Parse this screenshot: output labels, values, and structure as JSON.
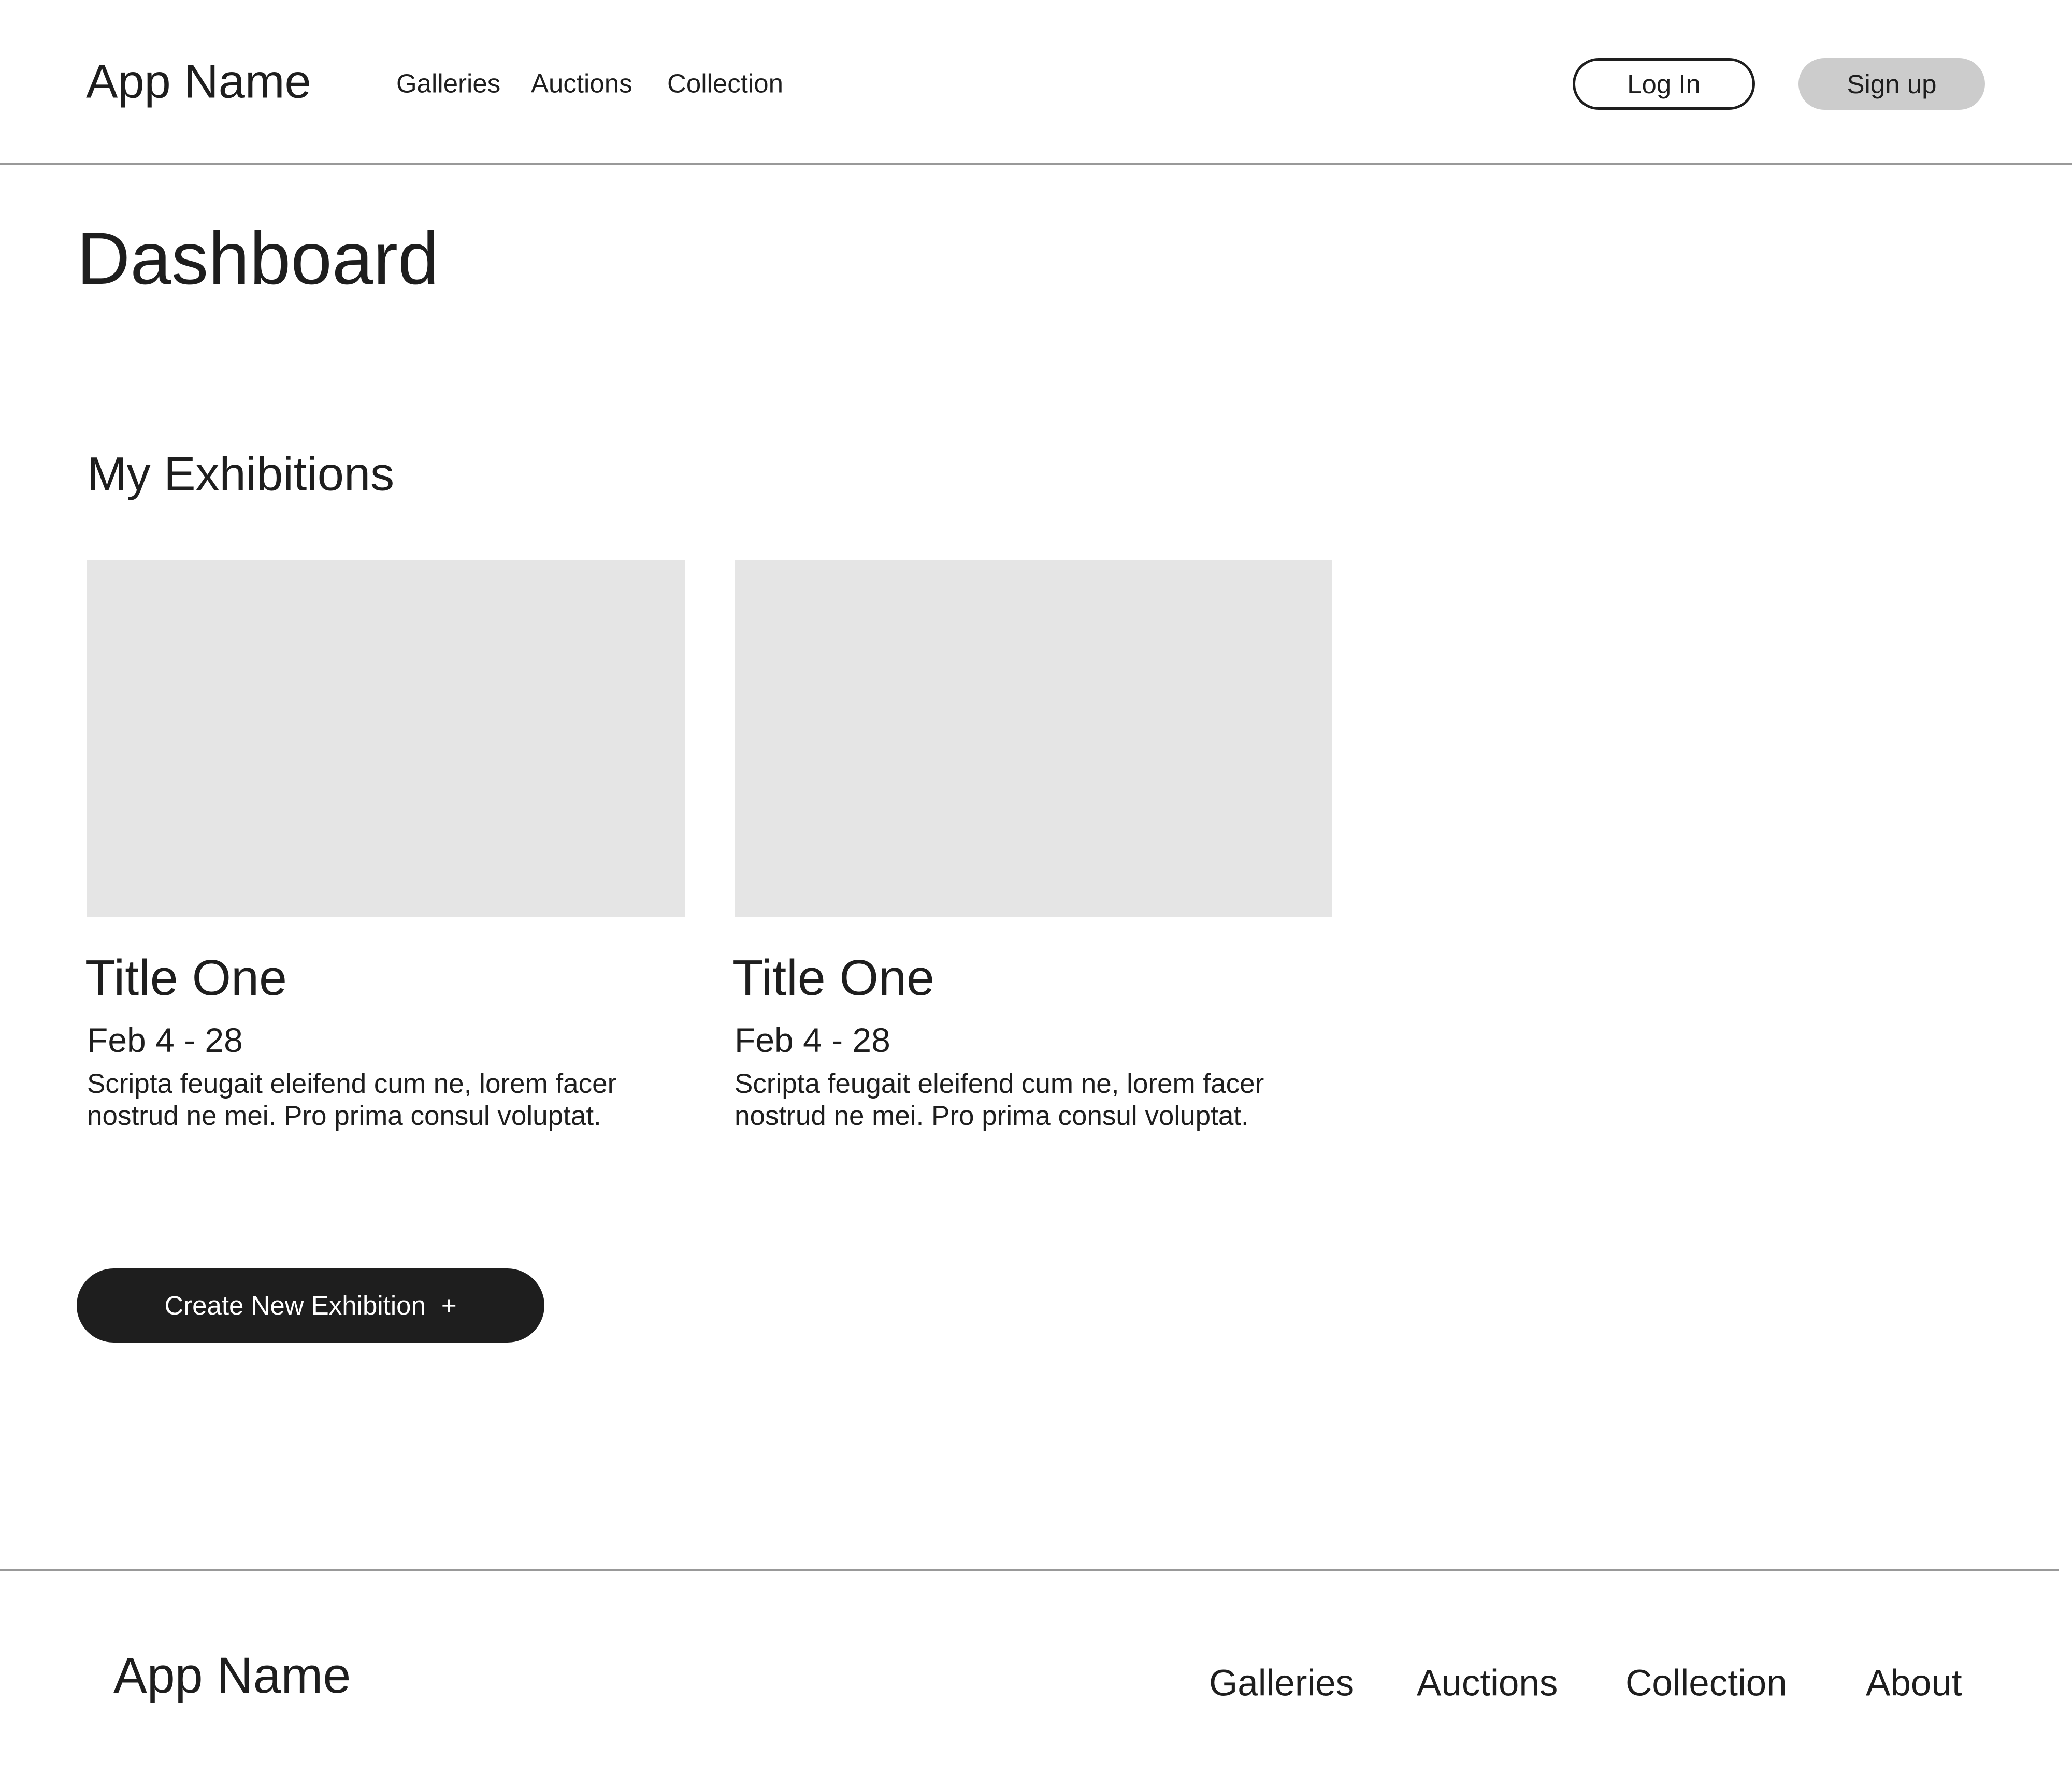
{
  "header": {
    "app_name": "App Name",
    "nav": [
      "Galleries",
      "Auctions",
      "Collection"
    ],
    "login_label": "Log In",
    "signup_label": "Sign up"
  },
  "main": {
    "page_title": "Dashboard",
    "section_title": "My Exhibitions",
    "exhibitions": [
      {
        "title": "Title One",
        "date": "Feb 4 - 28",
        "description": "Scripta feugait eleifend cum ne, lorem facer nostrud ne mei. Pro prima consul voluptat."
      },
      {
        "title": "Title One",
        "date": "Feb 4 - 28",
        "description": "Scripta feugait eleifend cum ne, lorem facer nostrud ne mei. Pro prima consul voluptat."
      }
    ],
    "create_button_label": "Create New Exhibition",
    "create_button_icon": "+"
  },
  "footer": {
    "app_name": "App Name",
    "links": [
      "Galleries",
      "Auctions",
      "Collection",
      "About"
    ]
  },
  "colors": {
    "text": "#1e1e1e",
    "placeholder": "#e5e5e5",
    "signup_bg": "#cccccc",
    "divider": "#999999"
  }
}
